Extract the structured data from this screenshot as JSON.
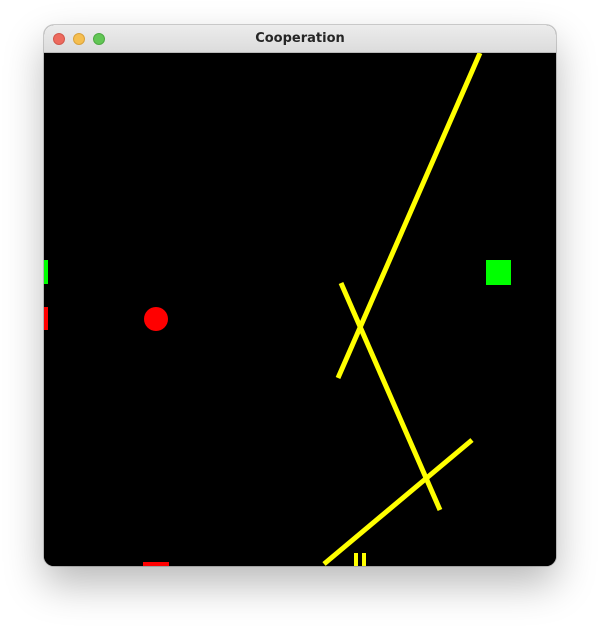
{
  "window": {
    "title": "Cooperation"
  },
  "game": {
    "background_color": "#000000",
    "line_color": "#ffff00",
    "entities": [
      {
        "id": "green-paddle-left",
        "kind": "paddle",
        "color": "#00ff00"
      },
      {
        "id": "red-paddle-left",
        "kind": "paddle",
        "color": "#ff0000"
      },
      {
        "id": "red-ball",
        "kind": "ball",
        "color": "#ff0000"
      },
      {
        "id": "green-target",
        "kind": "square",
        "color": "#00ff00"
      },
      {
        "id": "red-paddle-bottom",
        "kind": "paddle",
        "color": "#ff0000"
      },
      {
        "id": "yellow-paddle-bottom",
        "kind": "paddle",
        "color": "#ffff00"
      }
    ]
  }
}
